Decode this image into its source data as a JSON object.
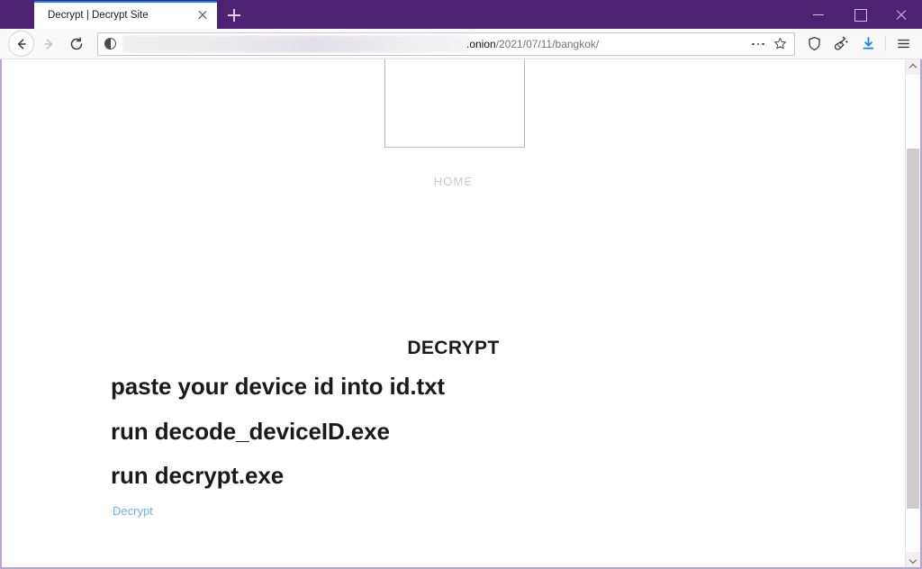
{
  "window": {
    "titlebar_color": "#4e2273",
    "controls": {
      "minimize": "minimize",
      "maximize": "maximize",
      "close": "close"
    }
  },
  "tabs": {
    "active_index": 0,
    "items": [
      {
        "title": "Decrypt | Decrypt Site",
        "close_label": "Close tab"
      }
    ],
    "new_tab_label": "New tab"
  },
  "navbar": {
    "back_label": "Go back one page",
    "forward_label": "Go forward one page",
    "reload_label": "Reload current page",
    "identity_icon": "split-circle-icon",
    "url": {
      "redacted_prefix": "",
      "host_suffix": ".onion",
      "path": "/2021/07/11/bangkok/",
      "full_display": ".onion/2021/07/11/bangkok/"
    },
    "page_actions_label": "Page actions",
    "bookmark_label": "Bookmark this page",
    "shield_label": "Tracking protection",
    "new_identity_label": "New Identity",
    "downloads_label": "Downloads",
    "menu_label": "Open application menu",
    "download_accent": "#0a84ff"
  },
  "page": {
    "nav_home": "HOME",
    "heading": "DECRYPT",
    "steps": [
      "paste your device id into id.txt",
      "run decode_deviceID.exe",
      "run decrypt.exe"
    ],
    "link": {
      "label": "Decrypt",
      "color": "#6cb2eb"
    },
    "logo_box_alt": "site logo placeholder"
  },
  "scrollbar": {
    "up_label": "Scroll up",
    "down_label": "Scroll down",
    "thumb_label": "Vertical scroll thumb"
  }
}
